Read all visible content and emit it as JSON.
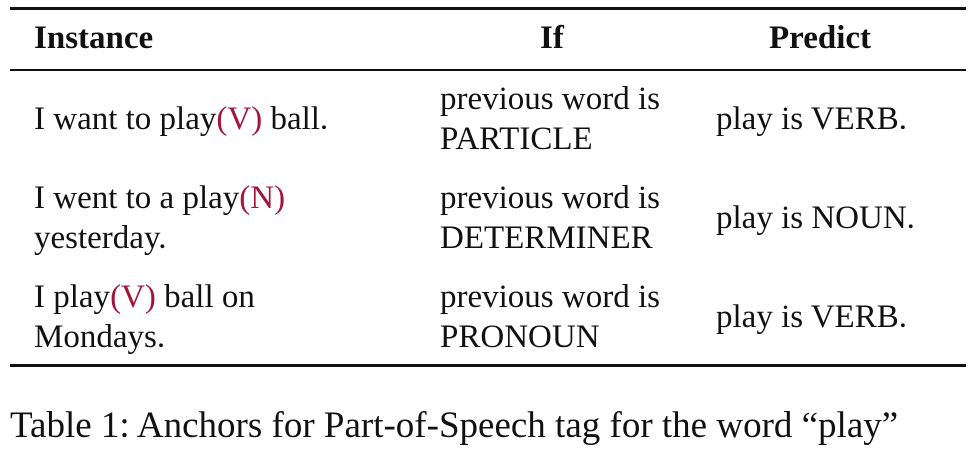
{
  "table": {
    "headers": {
      "instance": "Instance",
      "if": "If",
      "predict": "Predict"
    },
    "rows": [
      {
        "instance_pre": "I want to play",
        "instance_tag": "(V)",
        "instance_post": " ball.",
        "instance_line2": "",
        "if_line1": "previous word is",
        "if_line2": "PARTICLE",
        "predict": "play is VERB."
      },
      {
        "instance_pre": "I went to a play",
        "instance_tag": "(N)",
        "instance_post": "",
        "instance_line2": "yesterday.",
        "if_line1": "previous word is",
        "if_line2": "DETERMINER",
        "predict": "play is NOUN."
      },
      {
        "instance_pre": "I play",
        "instance_tag": "(V)",
        "instance_post": " ball on",
        "instance_line2": "Mondays.",
        "if_line1": "previous word is",
        "if_line2": "PRONOUN",
        "predict": "play is VERB."
      }
    ]
  },
  "caption": "Table 1: Anchors for Part-of-Speech tag for the word “play”",
  "colors": {
    "tag": "#a3143c",
    "text": "#111111",
    "rules": "#111111"
  }
}
